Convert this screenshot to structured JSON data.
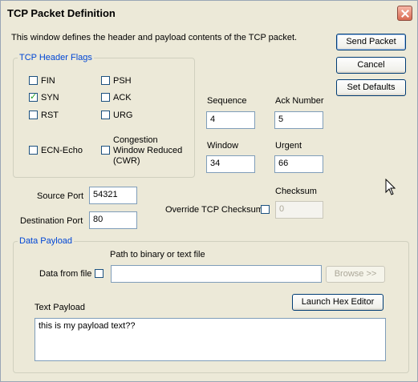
{
  "window": {
    "title": "TCP Packet Definition",
    "description": "This window defines the header and payload contents of the TCP packet."
  },
  "buttons": {
    "send_packet": "Send Packet",
    "cancel": "Cancel",
    "set_defaults": "Set Defaults",
    "browse": "Browse >>",
    "launch_hex_editor": "Launch Hex Editor"
  },
  "flags": {
    "group_title": "TCP Header Flags",
    "fin": {
      "label": "FIN",
      "checked": false
    },
    "syn": {
      "label": "SYN",
      "checked": true
    },
    "rst": {
      "label": "RST",
      "checked": false
    },
    "psh": {
      "label": "PSH",
      "checked": false
    },
    "ack": {
      "label": "ACK",
      "checked": false
    },
    "urg": {
      "label": "URG",
      "checked": false
    },
    "ecn_echo": {
      "label": "ECN-Echo",
      "checked": false
    },
    "cwr": {
      "label_line1": "Congestion",
      "label_line2": "Window Reduced",
      "label_line3": "(CWR)",
      "checked": false
    }
  },
  "fields": {
    "sequence_label": "Sequence",
    "sequence_value": "4",
    "ack_number_label": "Ack Number",
    "ack_number_value": "5",
    "window_label": "Window",
    "window_value": "34",
    "urgent_label": "Urgent",
    "urgent_value": "66",
    "source_port_label": "Source Port",
    "source_port_value": "54321",
    "destination_port_label": "Destination Port",
    "destination_port_value": "80",
    "override_checksum_label": "Override TCP Checksum",
    "checksum_label": "Checksum",
    "checksum_value": "0"
  },
  "payload": {
    "group_title": "Data Payload",
    "path_label": "Path to binary or text file",
    "data_from_file_label": "Data from file",
    "path_value": "",
    "text_payload_label": "Text Payload",
    "text_payload_value": "this is my payload text??"
  }
}
